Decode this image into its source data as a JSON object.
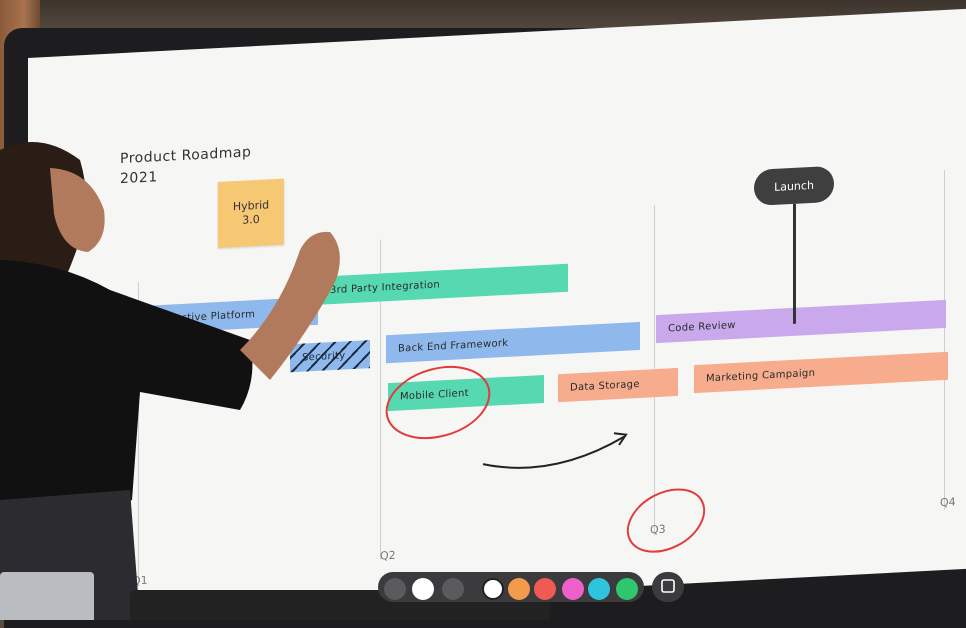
{
  "board": {
    "title": "Product Roadmap\n2021",
    "sticky_note": "Hybrid\n3.0",
    "launch_label": "Launch",
    "bars": {
      "b0": "Interactive Platform",
      "b1": "3rd Party Integration",
      "b2": "Security",
      "b3": "Back End Framework",
      "b4": "Mobile Client",
      "b5": "Data Storage",
      "b6": "Code Review",
      "b7": "Marketing Campaign"
    },
    "ticks": {
      "q1": "Q1",
      "q2": "Q2",
      "q3": "Q3",
      "q4": "Q4"
    }
  },
  "toolbar": {
    "icons": [
      "tools-icon",
      "pen-white-icon",
      "more-icon",
      "color-white",
      "color-orange",
      "color-red",
      "color-pink",
      "color-cyan",
      "color-green",
      "sticky-note-icon"
    ],
    "colors": {
      "white": "#ffffff",
      "orange": "#f39a4c",
      "red": "#ef5a54",
      "pink": "#ec60c8",
      "cyan": "#2fc4dd",
      "green": "#2ec76f"
    }
  },
  "colors": {
    "bar_blue": "#8fb8ec",
    "bar_teal": "#56d9b0",
    "bar_purple": "#c9a8ec",
    "bar_salmon": "#f7ad8d",
    "sticky_yellow": "#f6c874",
    "annotation_red": "#e23b3b"
  }
}
